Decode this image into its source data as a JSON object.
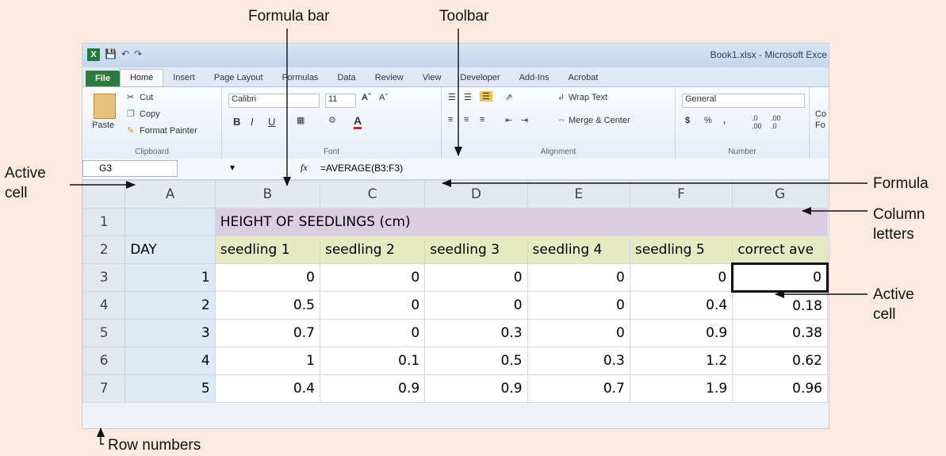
{
  "annotations": {
    "formula_bar": "Formula bar",
    "toolbar": "Toolbar",
    "active_cell_left_1": "Active",
    "active_cell_left_2": "cell",
    "formula_right": "Formula",
    "column_letters_1": "Column",
    "column_letters_2": "letters",
    "active_cell_right_1": "Active",
    "active_cell_right_2": "cell",
    "row_numbers": "Row numbers"
  },
  "window": {
    "title": "Book1.xlsx - Microsoft Exce",
    "app_icon": "X"
  },
  "tabs": [
    "File",
    "Home",
    "Insert",
    "Page Layout",
    "Formulas",
    "Data",
    "Review",
    "View",
    "Developer",
    "Add-Ins",
    "Acrobat"
  ],
  "ribbon": {
    "clipboard": {
      "paste": "Paste",
      "cut": "Cut",
      "copy": "Copy",
      "format_painter": "Format Painter",
      "label": "Clipboard"
    },
    "font": {
      "name": "Calibri",
      "size": "11",
      "bold": "B",
      "italic": "I",
      "underline": "U",
      "label": "Font"
    },
    "alignment": {
      "wrap_text": "Wrap Text",
      "merge_center": "Merge & Center",
      "label": "Alignment"
    },
    "number": {
      "format": "General",
      "currency": "$",
      "percent": "%",
      "comma": ",",
      "label": "Number"
    },
    "styles_partial_1": "Co",
    "styles_partial_2": "Fo"
  },
  "formula_bar": {
    "name_box": "G3",
    "fx": "fx",
    "formula": "=AVERAGE(B3:F3)"
  },
  "columns": [
    "A",
    "B",
    "C",
    "D",
    "E",
    "F",
    "G"
  ],
  "rows": [
    {
      "num": "1",
      "cells": [
        "",
        "HEIGHT OF SEEDLINGS (cm)"
      ]
    },
    {
      "num": "2",
      "cells": [
        "DAY",
        "seedling 1",
        "seedling 2",
        "seedling 3",
        "seedling 4",
        "seedling 5",
        "correct ave"
      ]
    },
    {
      "num": "3",
      "cells": [
        "1",
        "0",
        "0",
        "0",
        "0",
        "0",
        "0"
      ]
    },
    {
      "num": "4",
      "cells": [
        "2",
        "0.5",
        "0",
        "0",
        "0",
        "0.4",
        "0.18"
      ]
    },
    {
      "num": "5",
      "cells": [
        "3",
        "0.7",
        "0",
        "0.3",
        "0",
        "0.9",
        "0.38"
      ]
    },
    {
      "num": "6",
      "cells": [
        "4",
        "1",
        "0.1",
        "0.5",
        "0.3",
        "1.2",
        "0.62"
      ]
    },
    {
      "num": "7",
      "cells": [
        "5",
        "0.4",
        "0.9",
        "0.9",
        "0.7",
        "1.9",
        "0.96"
      ]
    }
  ]
}
